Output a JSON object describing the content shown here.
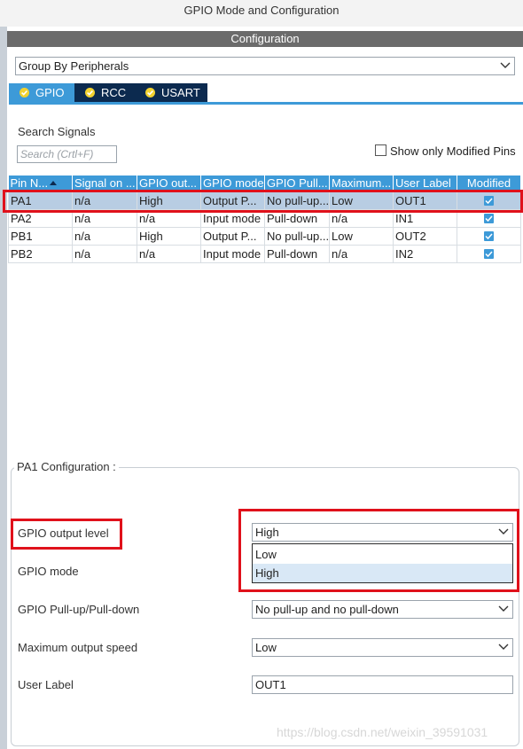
{
  "window": {
    "title": "GPIO Mode and Configuration"
  },
  "config": {
    "header": "Configuration",
    "group_by": "Group By Peripherals",
    "tabs": [
      {
        "label": "GPIO",
        "active": true
      },
      {
        "label": "RCC",
        "active": false
      },
      {
        "label": "USART",
        "active": false
      }
    ]
  },
  "search": {
    "title": "Search Signals",
    "placeholder": "Search (Crtl+F)",
    "show_modified_label": "Show only Modified Pins",
    "show_modified_checked": false
  },
  "table": {
    "columns": [
      "Pin N...",
      "Signal on ...",
      "GPIO out...",
      "GPIO mode",
      "GPIO Pull...",
      "Maximum...",
      "User Label",
      "Modified"
    ],
    "rows": [
      {
        "pin": "PA1",
        "signal": "n/a",
        "gpio_out": "High",
        "mode": "Output P...",
        "pull": "No pull-up...",
        "speed": "Low",
        "label": "OUT1",
        "modified": true,
        "selected": true
      },
      {
        "pin": "PA2",
        "signal": "n/a",
        "gpio_out": "n/a",
        "mode": "Input mode",
        "pull": "Pull-down",
        "speed": "n/a",
        "label": "IN1",
        "modified": true,
        "selected": false
      },
      {
        "pin": "PB1",
        "signal": "n/a",
        "gpio_out": "High",
        "mode": "Output P...",
        "pull": "No pull-up...",
        "speed": "Low",
        "label": "OUT2",
        "modified": true,
        "selected": false
      },
      {
        "pin": "PB2",
        "signal": "n/a",
        "gpio_out": "n/a",
        "mode": "Input mode",
        "pull": "Pull-down",
        "speed": "n/a",
        "label": "IN2",
        "modified": true,
        "selected": false
      }
    ]
  },
  "pin_config": {
    "legend": "PA1 Configuration :",
    "fields": {
      "output_level": {
        "label": "GPIO output level",
        "value": "High",
        "options": [
          "Low",
          "High"
        ],
        "highlighted_option": "High"
      },
      "mode": {
        "label": "GPIO mode"
      },
      "pull": {
        "label": "GPIO Pull-up/Pull-down",
        "value": "No pull-up and no pull-down"
      },
      "speed": {
        "label": "Maximum output speed",
        "value": "Low"
      },
      "user_label": {
        "label": "User Label",
        "value": "OUT1"
      }
    }
  },
  "watermark": "https://blog.csdn.net/weixin_39591031",
  "colors": {
    "accent": "#3d9ad8",
    "tab_dark": "#0c2a4f",
    "header_gray": "#6b6b6b",
    "selected_row": "#b8cde3",
    "annotation_red": "#e0111b"
  }
}
